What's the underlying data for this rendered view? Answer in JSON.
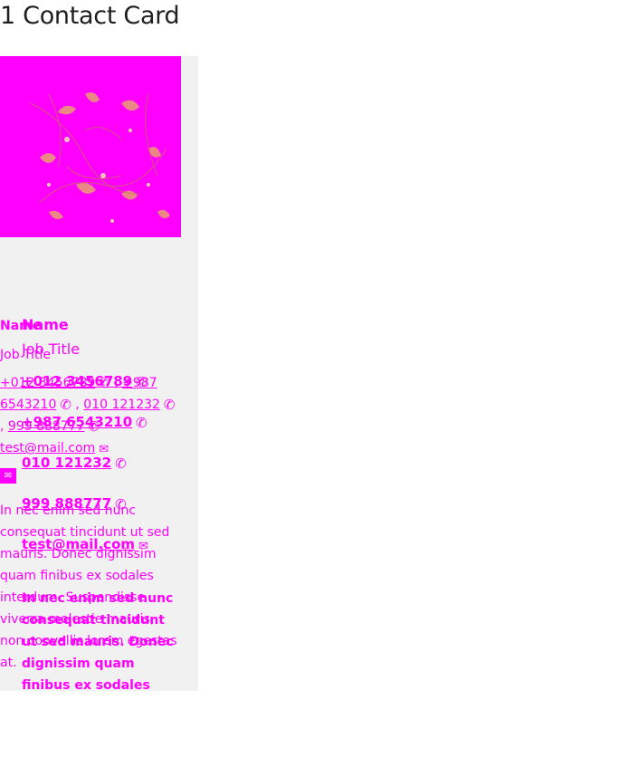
{
  "page": {
    "title": "1 Contact Card"
  },
  "colors": {
    "accent": "#ff00ff",
    "panel": "#f1f1f1",
    "title": "#1f1f1f"
  },
  "card": {
    "photo_alt": "contact photo",
    "name": "Name",
    "job_title": "Job Title",
    "phones": [
      "+012 3456789",
      "+987 6543210",
      "010 121232",
      "999 888777"
    ],
    "email": "test@mail.com",
    "bio": "In nec enim sed nunc consequat tincidunt ut sed mauris. Donec dignissim quam finibus ex sodales interdum. Suspendisse viverra molestie mauris, non convallis lorem egestas at."
  },
  "icons": {
    "phone": "phone-icon",
    "mail": "mail-icon"
  }
}
